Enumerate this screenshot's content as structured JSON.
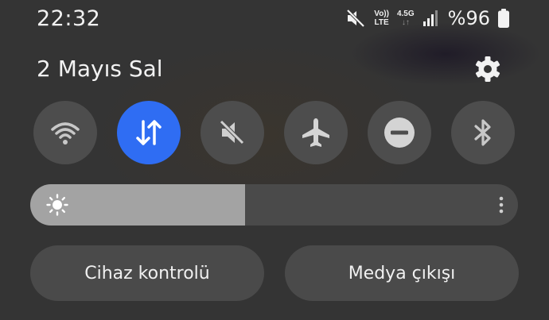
{
  "status_bar": {
    "time": "22:32",
    "volte_label": "Vo))",
    "lte_label": "LTE",
    "net_type": "4.5G",
    "battery_percent": "%96",
    "icons": [
      "mute-icon",
      "volte-icon",
      "data-activity-icon",
      "signal-icon",
      "battery-icon"
    ]
  },
  "panel": {
    "date": "2 Mayıs Sal"
  },
  "toggles": [
    {
      "name": "wifi",
      "icon": "wifi-icon",
      "active": false
    },
    {
      "name": "mobile-data",
      "icon": "data-arrows-icon",
      "active": true
    },
    {
      "name": "sound",
      "icon": "mute-icon",
      "active": false
    },
    {
      "name": "airplane",
      "icon": "airplane-icon",
      "active": false
    },
    {
      "name": "do-not-disturb",
      "icon": "dnd-icon",
      "active": false
    },
    {
      "name": "bluetooth",
      "icon": "bluetooth-icon",
      "active": false
    }
  ],
  "brightness": {
    "level": 0.44
  },
  "buttons": {
    "device_control": "Cihaz kontrolü",
    "media_output": "Medya çıkışı"
  },
  "colors": {
    "accent": "#2f6df3",
    "background": "#343434",
    "tile": "#4d4d4d"
  }
}
